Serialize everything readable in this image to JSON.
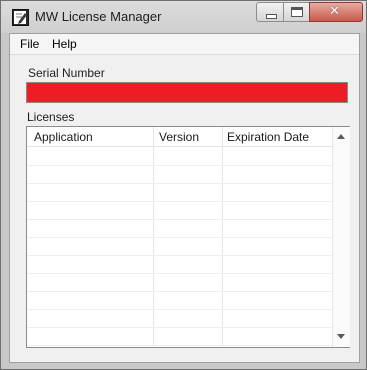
{
  "window": {
    "title": "MW License Manager",
    "accent_close": "#c8594a"
  },
  "menu": {
    "file": "File",
    "help": "Help"
  },
  "serial": {
    "label": "Serial Number",
    "value": "",
    "field_color": "#ee1c25"
  },
  "licenses": {
    "label": "Licenses",
    "columns": [
      "Application",
      "Version",
      "Expiration Date"
    ],
    "rows": []
  },
  "icons": {
    "app": "pencil-notepad-icon",
    "minimize": "minimize-icon",
    "maximize": "maximize-icon",
    "close": "close-icon",
    "scroll_up": "scroll-up-arrow-icon",
    "scroll_down": "scroll-down-arrow-icon"
  }
}
